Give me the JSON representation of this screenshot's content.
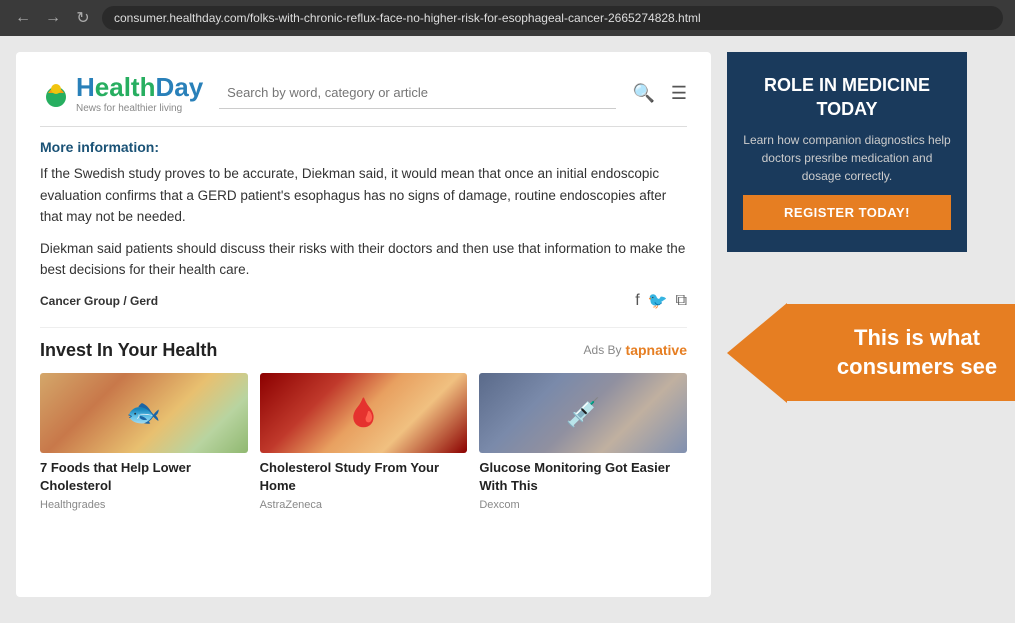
{
  "browser": {
    "url": "consumer.healthday.com/folks-with-chronic-reflux-face-no-higher-risk-for-esophageal-cancer-2665274828.html",
    "back_label": "←",
    "forward_label": "→",
    "reload_label": "↻"
  },
  "header": {
    "logo": "HealthDay",
    "logo_tagline": "News for healthier living",
    "search_placeholder": "Search by word, category or article"
  },
  "article": {
    "more_info": "More information:",
    "paragraph1": "If the Swedish study proves to be accurate, Diekman said, it would mean that once an initial endoscopic evaluation confirms that a GERD patient's esophagus has no signs of damage, routine endoscopies after that may not be needed.",
    "paragraph2": "Diekman said patients should discuss their risks with their doctors and then use that information to make the best decisions for their health care.",
    "category": "Cancer Group / Gerd"
  },
  "ads_section": {
    "title": "Invest In Your Health",
    "ads_by_label": "Ads By",
    "tapnative_label": "tapnative",
    "ads": [
      {
        "title": "7 Foods that Help Lower Cholesterol",
        "sponsor": "Healthgrades",
        "img_type": "salmon"
      },
      {
        "title": "Cholesterol Study From Your Home",
        "sponsor": "AstraZeneca",
        "img_type": "artery"
      },
      {
        "title": "Glucose Monitoring Got Easier With This",
        "sponsor": "Dexcom",
        "img_type": "glucose"
      }
    ]
  },
  "sidebar_ad": {
    "title": "ROLE IN MEDICINE TODAY",
    "subtitle": "Learn how companion diagnostics help doctors presribe medication and dosage correctly.",
    "button_label": "REGISTER TODAY!"
  },
  "annotation": {
    "text": "This is what consumers see"
  }
}
